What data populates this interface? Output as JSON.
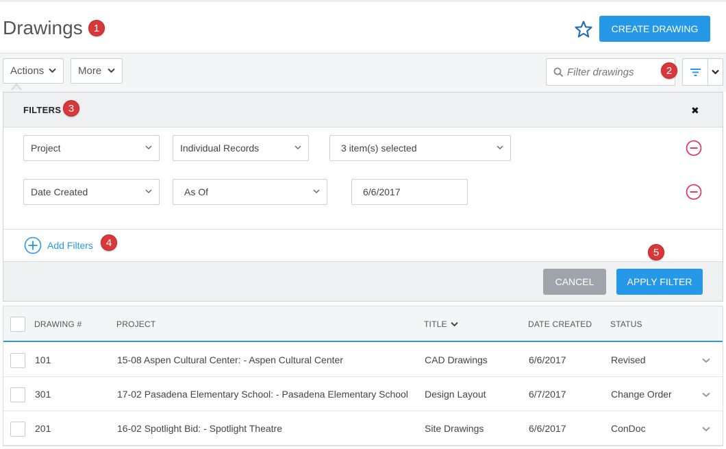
{
  "header": {
    "title": "Drawings",
    "create_label": "CREATE DRAWING"
  },
  "annotations": [
    "1",
    "2",
    "3",
    "4",
    "5"
  ],
  "toolbar": {
    "actions_label": "Actions",
    "more_label": "More",
    "search_placeholder": "Filter drawings"
  },
  "filters": {
    "title": "FILTERS",
    "rows": [
      {
        "field": "Project",
        "operator": "Individual Records",
        "value": "3 item(s) selected"
      },
      {
        "field": "Date Created",
        "operator": "As Of",
        "value": "6/6/2017"
      }
    ],
    "add_label": "Add Filters",
    "cancel_label": "CANCEL",
    "apply_label": "APPLY FILTER"
  },
  "table": {
    "columns": [
      "DRAWING #",
      "PROJECT",
      "TITLE",
      "DATE CREATED",
      "STATUS"
    ],
    "rows": [
      {
        "number": "101",
        "project": "15-08 Aspen Cultural Center: - Aspen Cultural Center",
        "title": "CAD Drawings",
        "date": "6/6/2017",
        "status": "Revised"
      },
      {
        "number": "301",
        "project": "17-02 Pasadena Elementary School: - Pasadena Elementary School",
        "title": "Design Layout",
        "date": "6/7/2017",
        "status": "Change Order"
      },
      {
        "number": "201",
        "project": "16-02 Spotlight Bid: - Spotlight Theatre",
        "title": "Site Drawings",
        "date": "6/6/2017",
        "status": "ConDoc"
      }
    ]
  },
  "colors": {
    "accent": "#2598e8",
    "badge": "#d9383a",
    "remove": "#e0245e",
    "cancel": "#9ea4a9"
  }
}
